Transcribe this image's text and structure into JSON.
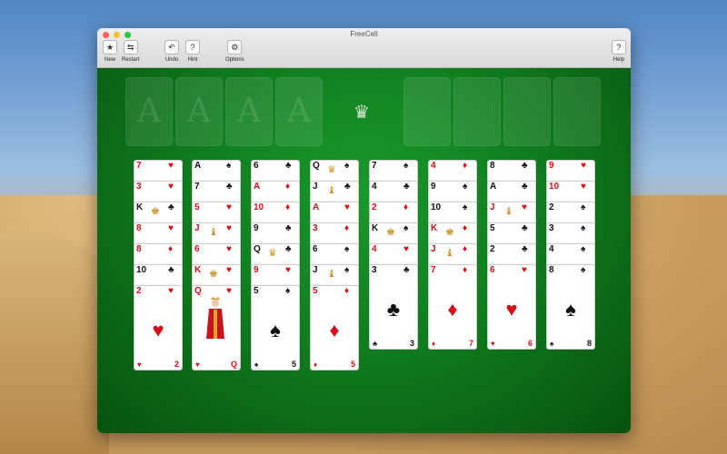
{
  "window": {
    "title": "FreeCell"
  },
  "toolbar": {
    "new": {
      "label": "New",
      "icon": "star-icon"
    },
    "restart": {
      "label": "Restart",
      "icon": "restart-icon"
    },
    "undo": {
      "label": "Undo",
      "icon": "undo-arrow-icon"
    },
    "hint": {
      "label": "Hint",
      "icon": "hint-bubble-icon"
    },
    "options": {
      "label": "Options",
      "icon": "gears-icon"
    },
    "help": {
      "label": "Help",
      "icon": "help-icon"
    }
  },
  "foundations": [
    "A",
    "A",
    "A",
    "A"
  ],
  "freecells": [
    "",
    "",
    "",
    ""
  ],
  "colors": {
    "felt": "#0f7d1e",
    "red_suit": "#d80f17",
    "black_suit": "#111111"
  },
  "columns": [
    {
      "cards": [
        {
          "rank": "7",
          "suit": "♥",
          "color": "red"
        },
        {
          "rank": "3",
          "suit": "♥",
          "color": "red"
        },
        {
          "rank": "K",
          "suit": "♣",
          "color": "black"
        },
        {
          "rank": "8",
          "suit": "♥",
          "color": "red"
        },
        {
          "rank": "8",
          "suit": "♦",
          "color": "red"
        },
        {
          "rank": "10",
          "suit": "♣",
          "color": "black"
        },
        {
          "rank": "2",
          "suit": "♥",
          "color": "red"
        }
      ]
    },
    {
      "cards": [
        {
          "rank": "A",
          "suit": "♠",
          "color": "black"
        },
        {
          "rank": "7",
          "suit": "♣",
          "color": "black"
        },
        {
          "rank": "5",
          "suit": "♥",
          "color": "red"
        },
        {
          "rank": "J",
          "suit": "♥",
          "color": "red"
        },
        {
          "rank": "6",
          "suit": "♥",
          "color": "red"
        },
        {
          "rank": "K",
          "suit": "♥",
          "color": "red"
        },
        {
          "rank": "Q",
          "suit": "♥",
          "color": "red"
        }
      ]
    },
    {
      "cards": [
        {
          "rank": "6",
          "suit": "♣",
          "color": "black"
        },
        {
          "rank": "A",
          "suit": "♦",
          "color": "red"
        },
        {
          "rank": "10",
          "suit": "♦",
          "color": "red"
        },
        {
          "rank": "9",
          "suit": "♣",
          "color": "black"
        },
        {
          "rank": "Q",
          "suit": "♣",
          "color": "black"
        },
        {
          "rank": "9",
          "suit": "♥",
          "color": "red"
        },
        {
          "rank": "5",
          "suit": "♠",
          "color": "black"
        }
      ]
    },
    {
      "cards": [
        {
          "rank": "Q",
          "suit": "♠",
          "color": "black"
        },
        {
          "rank": "J",
          "suit": "♣",
          "color": "black"
        },
        {
          "rank": "A",
          "suit": "♥",
          "color": "red"
        },
        {
          "rank": "3",
          "suit": "♦",
          "color": "red"
        },
        {
          "rank": "6",
          "suit": "♠",
          "color": "black"
        },
        {
          "rank": "J",
          "suit": "♠",
          "color": "black"
        },
        {
          "rank": "5",
          "suit": "♦",
          "color": "red"
        }
      ]
    },
    {
      "cards": [
        {
          "rank": "7",
          "suit": "♠",
          "color": "black"
        },
        {
          "rank": "4",
          "suit": "♣",
          "color": "black"
        },
        {
          "rank": "2",
          "suit": "♦",
          "color": "red"
        },
        {
          "rank": "K",
          "suit": "♠",
          "color": "black"
        },
        {
          "rank": "4",
          "suit": "♥",
          "color": "red"
        },
        {
          "rank": "3",
          "suit": "♣",
          "color": "black"
        }
      ]
    },
    {
      "cards": [
        {
          "rank": "4",
          "suit": "♦",
          "color": "red"
        },
        {
          "rank": "9",
          "suit": "♠",
          "color": "black"
        },
        {
          "rank": "10",
          "suit": "♠",
          "color": "black"
        },
        {
          "rank": "K",
          "suit": "♦",
          "color": "red"
        },
        {
          "rank": "J",
          "suit": "♦",
          "color": "red"
        },
        {
          "rank": "7",
          "suit": "♦",
          "color": "red"
        }
      ]
    },
    {
      "cards": [
        {
          "rank": "8",
          "suit": "♣",
          "color": "black"
        },
        {
          "rank": "A",
          "suit": "♣",
          "color": "black"
        },
        {
          "rank": "J",
          "suit": "♥",
          "color": "red"
        },
        {
          "rank": "5",
          "suit": "♣",
          "color": "black"
        },
        {
          "rank": "2",
          "suit": "♣",
          "color": "black"
        },
        {
          "rank": "6",
          "suit": "♥",
          "color": "red"
        }
      ]
    },
    {
      "cards": [
        {
          "rank": "9",
          "suit": "♥",
          "color": "red"
        },
        {
          "rank": "10",
          "suit": "♥",
          "color": "red"
        },
        {
          "rank": "2",
          "suit": "♠",
          "color": "black"
        },
        {
          "rank": "3",
          "suit": "♠",
          "color": "black"
        },
        {
          "rank": "4",
          "suit": "♠",
          "color": "black"
        },
        {
          "rank": "8",
          "suit": "♠",
          "color": "black"
        }
      ]
    }
  ]
}
